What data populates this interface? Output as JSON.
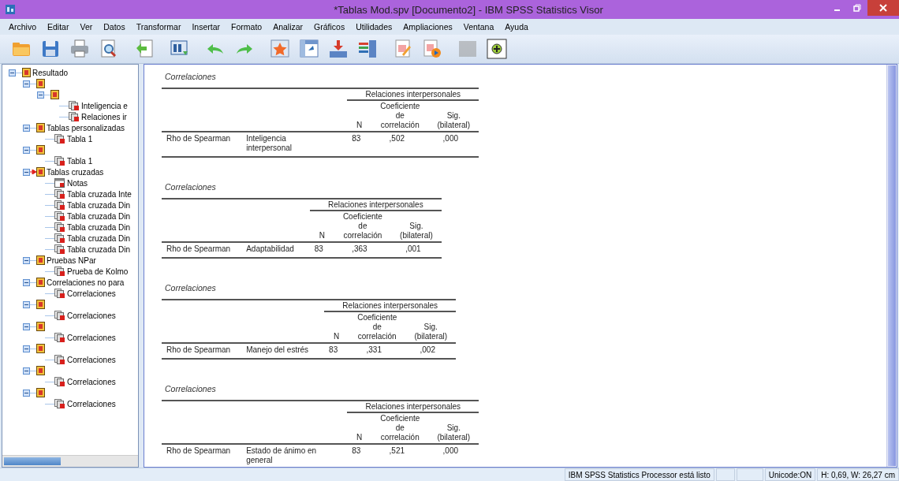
{
  "window": {
    "title": "*Tablas Mod.spv [Documento2] - IBM SPSS Statistics Visor"
  },
  "menu": [
    "Archivo",
    "Editar",
    "Ver",
    "Datos",
    "Transformar",
    "Insertar",
    "Formato",
    "Analizar",
    "Gráficos",
    "Utilidades",
    "Ampliaciones",
    "Ventana",
    "Ayuda"
  ],
  "toolbar": [
    {
      "kind": "open",
      "disabled": false
    },
    {
      "kind": "save",
      "disabled": false
    },
    {
      "kind": "print",
      "disabled": false
    },
    {
      "kind": "preview",
      "disabled": false
    },
    {
      "kind": "export",
      "disabled": false
    },
    {
      "kind": "data",
      "disabled": false
    },
    {
      "kind": "undo",
      "disabled": false
    },
    {
      "kind": "redo",
      "disabled": false
    },
    {
      "kind": "star",
      "disabled": false
    },
    {
      "kind": "pivot",
      "disabled": false
    },
    {
      "kind": "insert",
      "disabled": false
    },
    {
      "kind": "bars",
      "disabled": false
    },
    {
      "kind": "edit",
      "disabled": false
    },
    {
      "kind": "play",
      "disabled": false
    },
    {
      "kind": "blank",
      "disabled": true
    },
    {
      "kind": "add",
      "disabled": false
    }
  ],
  "tree": [
    {
      "kind": "book",
      "label": "Resultado",
      "expanded": true,
      "current": false,
      "children": [
        {
          "kind": "book",
          "expanded": true,
          "current": false,
          "children": [
            {
              "kind": "book",
              "expanded": true,
              "current": false,
              "children": [
                {
                  "kind": "table",
                  "label": "Inteligencia e",
                  "current": false
                },
                {
                  "kind": "table",
                  "label": "Relaciones ir",
                  "current": false
                }
              ]
            }
          ]
        },
        {
          "kind": "book",
          "label": "Tablas personalizadas",
          "expanded": true,
          "current": false,
          "children": [
            {
              "kind": "table",
              "label": "Tabla 1",
              "current": false
            }
          ]
        },
        {
          "kind": "book",
          "expanded": true,
          "current": false,
          "children": [
            {
              "kind": "table",
              "label": "Tabla 1",
              "current": false
            }
          ]
        },
        {
          "kind": "book",
          "label": "Tablas cruzadas",
          "expanded": true,
          "current": true,
          "children": [
            {
              "kind": "notes",
              "label": "Notas",
              "current": false
            },
            {
              "kind": "table",
              "label": "Tabla cruzada Inte",
              "current": false
            },
            {
              "kind": "table",
              "label": "Tabla cruzada Din",
              "current": false
            },
            {
              "kind": "table",
              "label": "Tabla cruzada Din",
              "current": false
            },
            {
              "kind": "table",
              "label": "Tabla cruzada Din",
              "current": false
            },
            {
              "kind": "table",
              "label": "Tabla cruzada Din",
              "current": false
            },
            {
              "kind": "table",
              "label": "Tabla cruzada Din",
              "current": false
            }
          ]
        },
        {
          "kind": "book",
          "label": "Pruebas NPar",
          "expanded": true,
          "current": false,
          "children": [
            {
              "kind": "table",
              "label": "Prueba de Kolmo",
              "current": false
            }
          ]
        },
        {
          "kind": "book",
          "label": "Correlaciones no para",
          "expanded": true,
          "current": false,
          "children": [
            {
              "kind": "table",
              "label": "Correlaciones",
              "current": false
            }
          ]
        },
        {
          "kind": "book",
          "expanded": true,
          "current": false,
          "children": [
            {
              "kind": "table",
              "label": "Correlaciones",
              "current": false
            }
          ]
        },
        {
          "kind": "book",
          "expanded": true,
          "current": false,
          "children": [
            {
              "kind": "table",
              "label": "Correlaciones",
              "current": false
            }
          ]
        },
        {
          "kind": "book",
          "expanded": true,
          "current": false,
          "children": [
            {
              "kind": "table",
              "label": "Correlaciones",
              "current": false
            }
          ]
        },
        {
          "kind": "book",
          "expanded": true,
          "current": false,
          "children": [
            {
              "kind": "table",
              "label": "Correlaciones",
              "current": false
            }
          ]
        },
        {
          "kind": "book",
          "expanded": true,
          "current": false,
          "children": [
            {
              "kind": "table",
              "label": "Correlaciones",
              "current": false
            }
          ]
        }
      ]
    }
  ],
  "tables": [
    {
      "title": "Correlaciones",
      "group_header": "Relaciones interpersonales",
      "columns": [
        "N",
        "Coeficiente de correlación",
        "Sig. (bilateral)"
      ],
      "row": {
        "method": "Rho de Spearman",
        "variable": "Inteligencia interpersonal",
        "cells": [
          "83",
          ",502",
          ",000"
        ]
      }
    },
    {
      "title": "Correlaciones",
      "group_header": "Relaciones interpersonales",
      "columns": [
        "N",
        "Coeficiente de correlación",
        "Sig. (bilateral)"
      ],
      "row": {
        "method": "Rho de Spearman",
        "variable": "Adaptabilidad",
        "cells": [
          "83",
          ",363",
          ",001"
        ]
      }
    },
    {
      "title": "Correlaciones",
      "group_header": "Relaciones interpersonales",
      "columns": [
        "N",
        "Coeficiente de correlación",
        "Sig. (bilateral)"
      ],
      "row": {
        "method": "Rho de Spearman",
        "variable": "Manejo del estrés",
        "cells": [
          "83",
          ",331",
          ",002"
        ]
      }
    },
    {
      "title": "Correlaciones",
      "group_header": "Relaciones interpersonales",
      "columns": [
        "N",
        "Coeficiente de correlación",
        "Sig. (bilateral)"
      ],
      "row": {
        "method": "Rho de Spearman",
        "variable": "Estado de ánimo en general",
        "cells": [
          "83",
          ",521",
          ",000"
        ]
      }
    }
  ],
  "status_bar": {
    "message": "IBM SPSS Statistics Processor está listo",
    "encoding": "Unicode:ON",
    "size": "H: 0,69, W: 26,27 cm"
  }
}
